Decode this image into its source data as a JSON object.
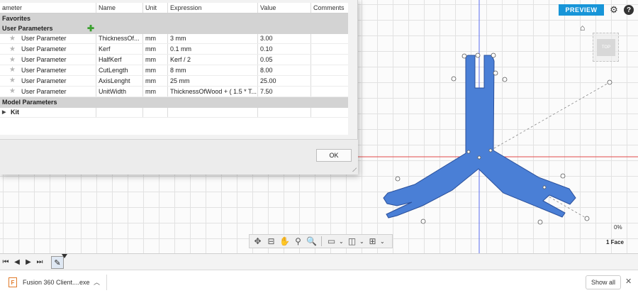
{
  "toolbar": {
    "preview_label": "PREVIEW",
    "settings_icon": "gear-icon",
    "help_label": "?"
  },
  "viewcube": {
    "face_label": "TOP"
  },
  "status": {
    "percent": "0%",
    "selection": "1 Face"
  },
  "accent_color": "#1795d8",
  "sketch_color": "#4a7fd6",
  "parameters": {
    "columns": [
      "ameter",
      "Name",
      "Unit",
      "Expression",
      "Value",
      "Comments"
    ],
    "groups": {
      "favorites": "Favorites",
      "user": "User Parameters",
      "model": "Model Parameters",
      "kit": "Kit"
    },
    "rows": [
      {
        "type": "User Parameter",
        "name": "ThicknessOf...",
        "unit": "mm",
        "expression": "3 mm",
        "value": "3.00"
      },
      {
        "type": "User Parameter",
        "name": "Kerf",
        "unit": "mm",
        "expression": "0.1 mm",
        "value": "0.10"
      },
      {
        "type": "User Parameter",
        "name": "HalfKerf",
        "unit": "mm",
        "expression": "Kerf / 2",
        "value": "0.05"
      },
      {
        "type": "User Parameter",
        "name": "CutLength",
        "unit": "mm",
        "expression": "8 mm",
        "value": "8.00"
      },
      {
        "type": "User Parameter",
        "name": "AxisLenght",
        "unit": "mm",
        "expression": "25 mm",
        "value": "25.00"
      },
      {
        "type": "User Parameter",
        "name": "UnitWidth",
        "unit": "mm",
        "expression": "ThicknessOfWood + ( 1.5 * T...",
        "value": "7.50"
      }
    ],
    "ok_label": "OK"
  },
  "downloads": {
    "file_name": "Fusion 360 Client....exe",
    "show_all_label": "Show all"
  }
}
